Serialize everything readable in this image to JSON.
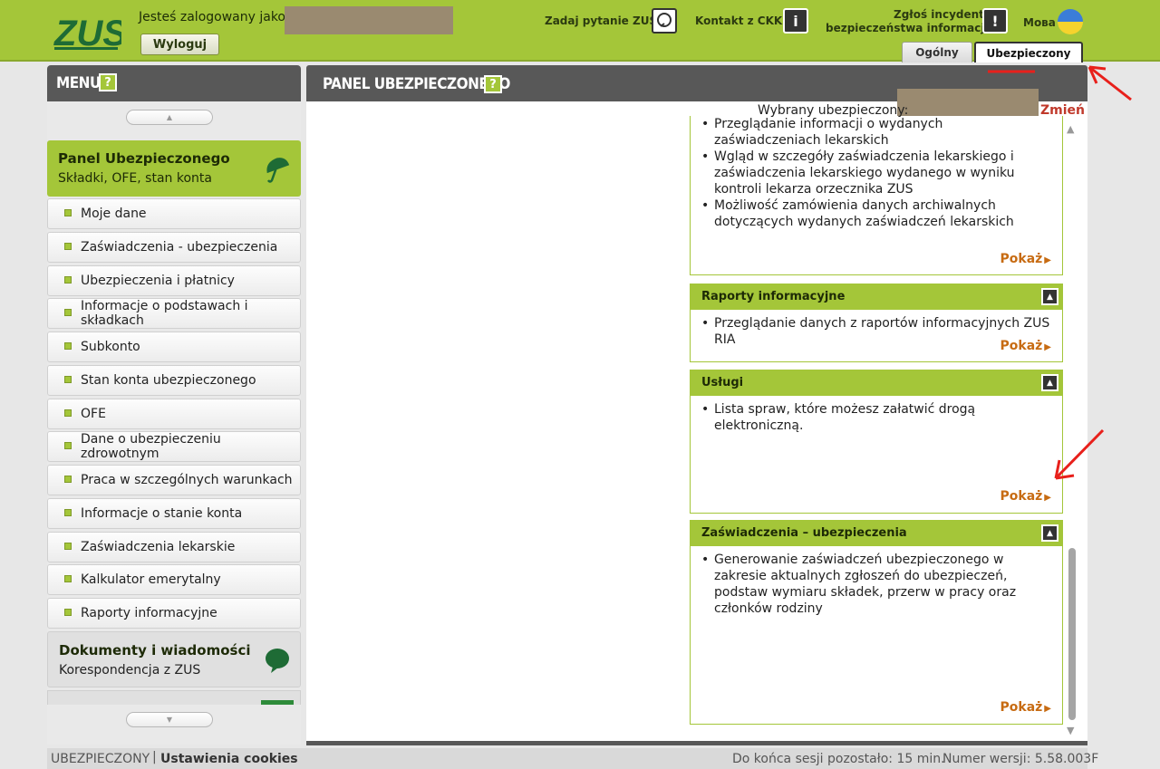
{
  "header": {
    "logo_text": "ZUS",
    "logged_in_label": "Jesteś zalogowany jako:",
    "logout_label": "Wyloguj",
    "ask_label": "Zadaj pytanie ZUS",
    "contact_label": "Kontakt z CKK",
    "incident_line1": "Zgłoś incydent",
    "incident_line2": "bezpieczeństwa informacji",
    "language_label": "Мова",
    "tabs": [
      {
        "label": "Ogólny",
        "active": false
      },
      {
        "label": "Ubezpieczony",
        "active": true
      }
    ]
  },
  "sidebar": {
    "title": "MENU",
    "help_icon": "?",
    "panel": {
      "title": "Panel Ubezpieczonego",
      "subtitle": "Składki, OFE, stan konta"
    },
    "items": [
      {
        "label": "Moje dane"
      },
      {
        "label": "Zaświadczenia - ubezpieczenia"
      },
      {
        "label": "Ubezpieczenia i płatnicy"
      },
      {
        "label": "Informacje o podstawach i składkach"
      },
      {
        "label": "Subkonto"
      },
      {
        "label": "Stan konta ubezpieczonego"
      },
      {
        "label": "OFE"
      },
      {
        "label": "Dane o ubezpieczeniu zdrowotnym"
      },
      {
        "label": "Praca w szczególnych warunkach"
      },
      {
        "label": "Informacje o stanie konta"
      },
      {
        "label": "Zaświadczenia lekarskie"
      },
      {
        "label": "Kalkulator emerytalny"
      },
      {
        "label": "Raporty informacyjne"
      }
    ],
    "docs": {
      "title": "Dokumenty i wiadomości",
      "subtitle": "Korespondencja z ZUS"
    }
  },
  "main": {
    "title": "PANEL UBEZPIECZONEGO",
    "help_icon": "?",
    "selected_label": "Wybrany ubezpieczony:",
    "change_label": "Zmień",
    "boxes": [
      {
        "title": "",
        "items": [
          "Przeglądanie informacji o wydanych zaświadczeniach lekarskich",
          "Wgląd w szczegóły zaświadczenia lekarskiego i zaświadczenia lekarskiego wydanego w wyniku kontroli lekarza orzecznika ZUS",
          "Możliwość zamówienia danych archiwalnych dotyczących wydanych zaświadczeń lekarskich"
        ],
        "link": "Pokaż"
      },
      {
        "title": "Raporty informacyjne",
        "items": [
          "Przeglądanie danych z raportów informacyjnych ZUS RIA"
        ],
        "link": "Pokaż"
      },
      {
        "title": "Usługi",
        "items": [
          "Lista spraw, które możesz załatwić drogą elektroniczną."
        ],
        "link": "Pokaż"
      },
      {
        "title": "Zaświadczenia – ubezpieczenia",
        "items": [
          "Generowanie zaświadczeń ubezpieczonego w zakresie aktualnych zgłoszeń do ubezpieczeń, podstaw wymiaru składek, przerw w pracy oraz członków rodziny"
        ],
        "link": "Pokaż"
      }
    ]
  },
  "footer": {
    "role": "UBEZPIECZONY",
    "separator": "|",
    "cookies": "Ustawienia cookies",
    "session": "Do końca sesji pozostało: 15 min.",
    "version": "Numer wersji: 5.58.003F"
  },
  "colors": {
    "brand_green": "#a4c639",
    "dark_header": "#585858",
    "link_orange": "#c76b12",
    "annotation_red": "#e8201b"
  }
}
